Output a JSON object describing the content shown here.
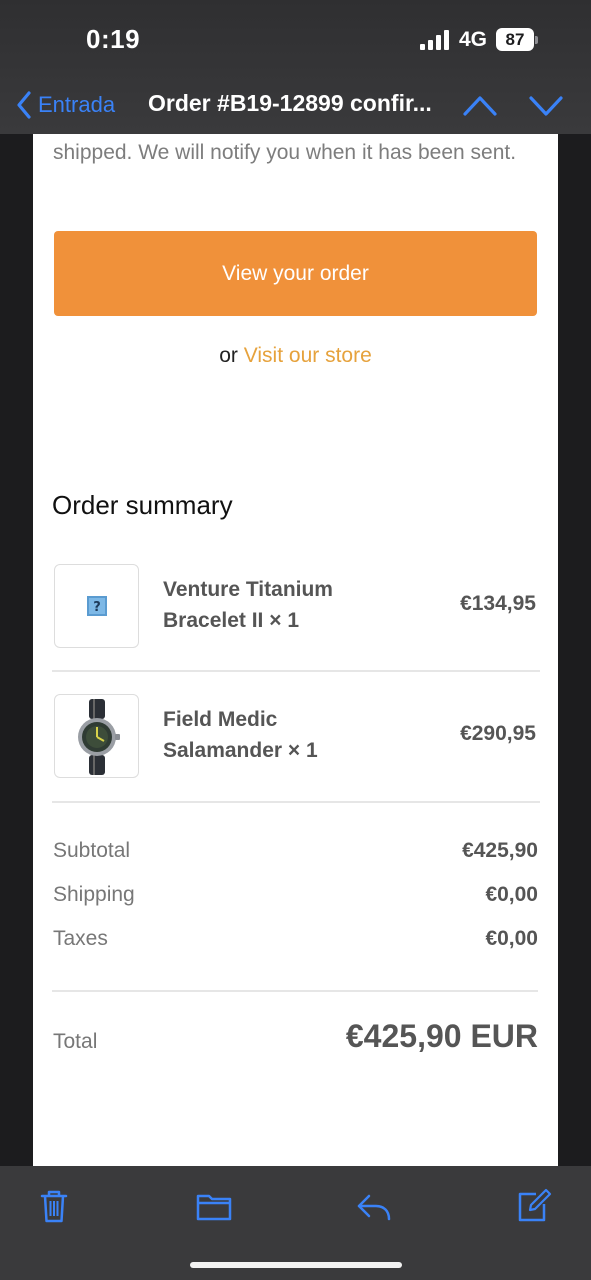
{
  "status_bar": {
    "time": "0:19",
    "network": "4G",
    "battery": "87"
  },
  "nav": {
    "back_label": "Entrada",
    "title": "Order #B19-12899 confir..."
  },
  "email": {
    "intro_text": "shipped. We will notify you when it has been sent.",
    "view_order_label": "View your order",
    "or_text": "or",
    "store_link_label": "Visit our store",
    "summary_title": "Order summary",
    "items": [
      {
        "name": "Venture Titanium Bracelet II × 1",
        "price": "€134,95",
        "image": "image-placeholder-icon"
      },
      {
        "name": "Field Medic Salamander × 1",
        "price": "€290,95",
        "image": "watch-icon"
      }
    ],
    "totals": [
      {
        "label": "Subtotal",
        "value": "€425,90"
      },
      {
        "label": "Shipping",
        "value": "€0,00"
      },
      {
        "label": "Taxes",
        "value": "€0,00"
      }
    ],
    "grand_total": {
      "label": "Total",
      "value": "€425,90 EUR"
    }
  },
  "toolbar": {
    "icons": [
      "trash-icon",
      "folder-icon",
      "reply-icon",
      "compose-icon"
    ]
  },
  "colors": {
    "accent": "#f0913a",
    "link": "#e6a23c",
    "ios_blue": "#3a82f7"
  }
}
